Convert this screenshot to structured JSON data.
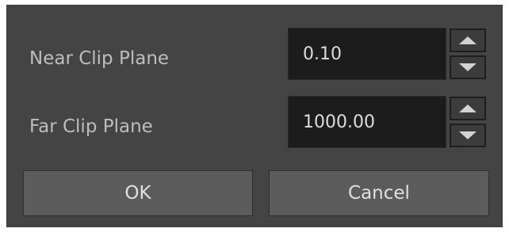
{
  "dialog": {
    "near_clip": {
      "label": "Near Clip Plane",
      "value": "0.10"
    },
    "far_clip": {
      "label": "Far Clip Plane",
      "value": "1000.00"
    },
    "ok_label": "OK",
    "cancel_label": "Cancel"
  },
  "icons": {
    "increment": "triangle-up-icon",
    "decrement": "triangle-down-icon"
  },
  "colors": {
    "dialog_bg": "#444444",
    "input_bg": "#1c1c1c",
    "button_bg": "#5c5c5c",
    "label_text": "#bdbdbd"
  }
}
